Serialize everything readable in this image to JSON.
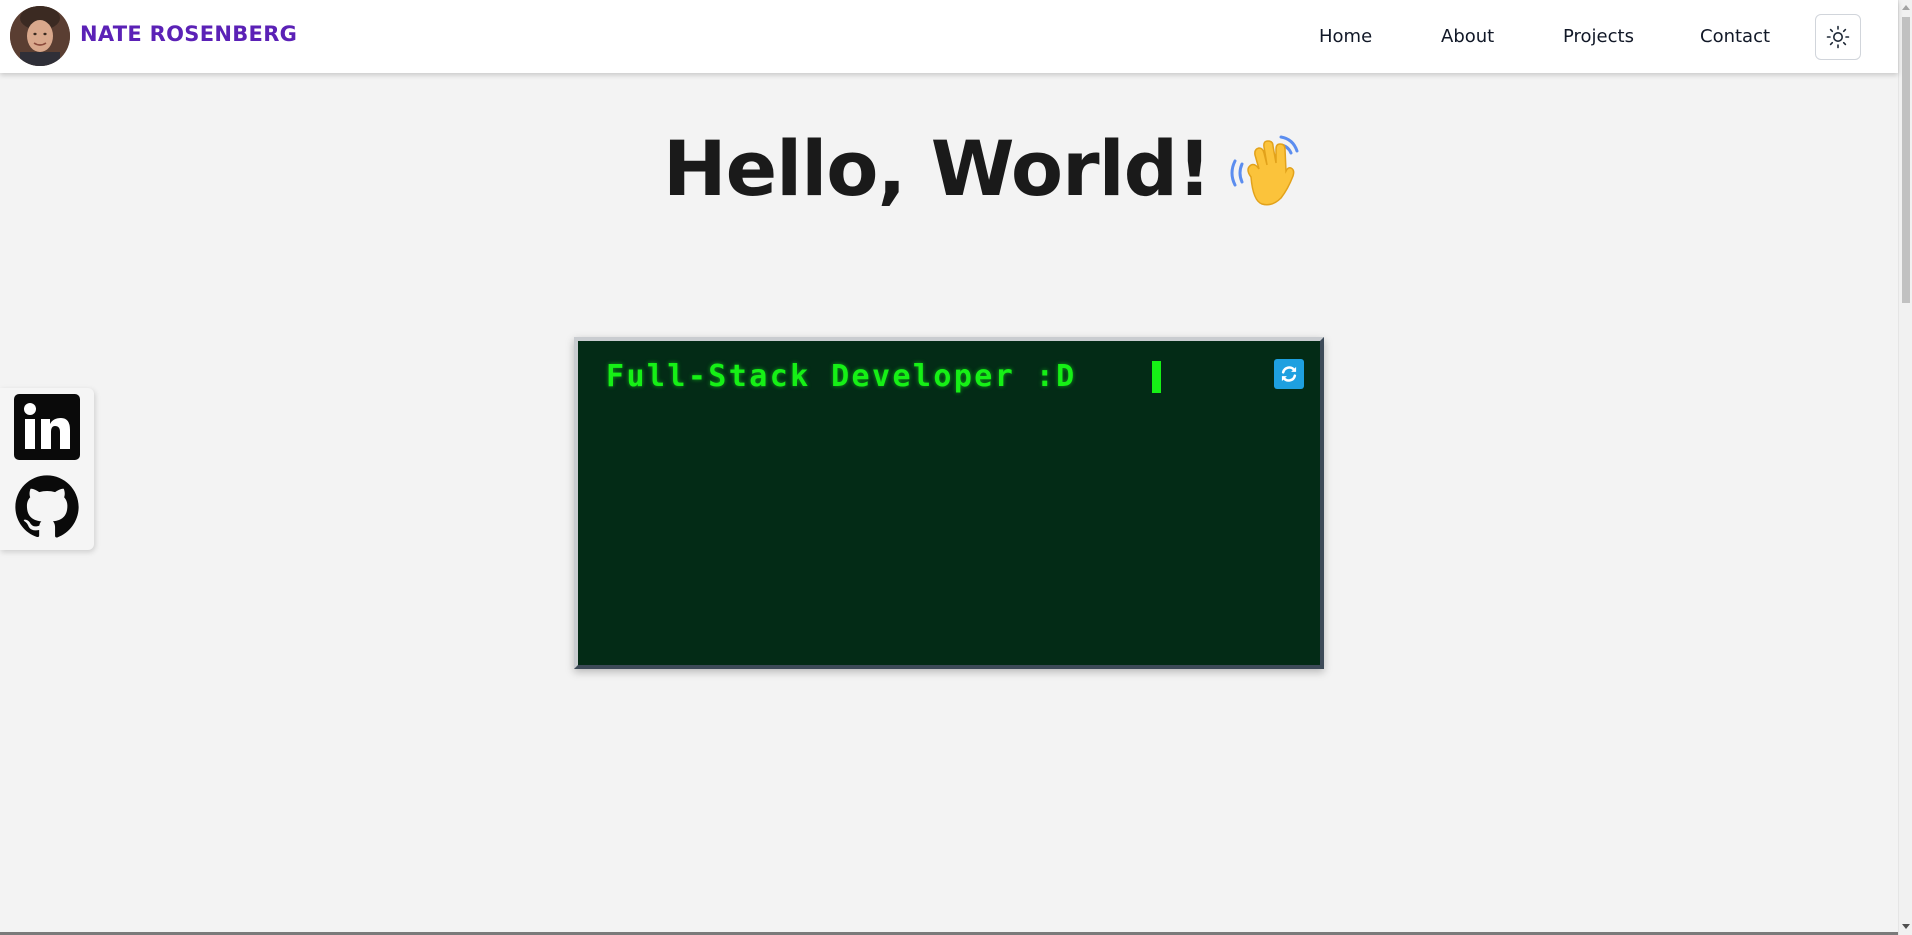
{
  "header": {
    "brand": "NATE ROSENBERG",
    "nav": [
      {
        "label": "Home"
      },
      {
        "label": "About"
      },
      {
        "label": "Projects"
      },
      {
        "label": "Contact"
      }
    ],
    "theme_toggle_icon": "sun-icon",
    "avatar_icon": "profile-photo"
  },
  "hero": {
    "title": "Hello, World!",
    "emoji_icon": "waving-hand-icon"
  },
  "social": {
    "items": [
      {
        "icon": "linkedin-icon"
      },
      {
        "icon": "github-icon"
      }
    ]
  },
  "terminal": {
    "text": "Full-Stack Developer :D",
    "refresh_icon": "refresh-icon"
  },
  "colors": {
    "brand": "#5b21b6",
    "page_bg": "#f3f3f3",
    "terminal_bg": "#032b16",
    "terminal_text": "#16f016",
    "refresh_button": "#1ea0e0"
  }
}
